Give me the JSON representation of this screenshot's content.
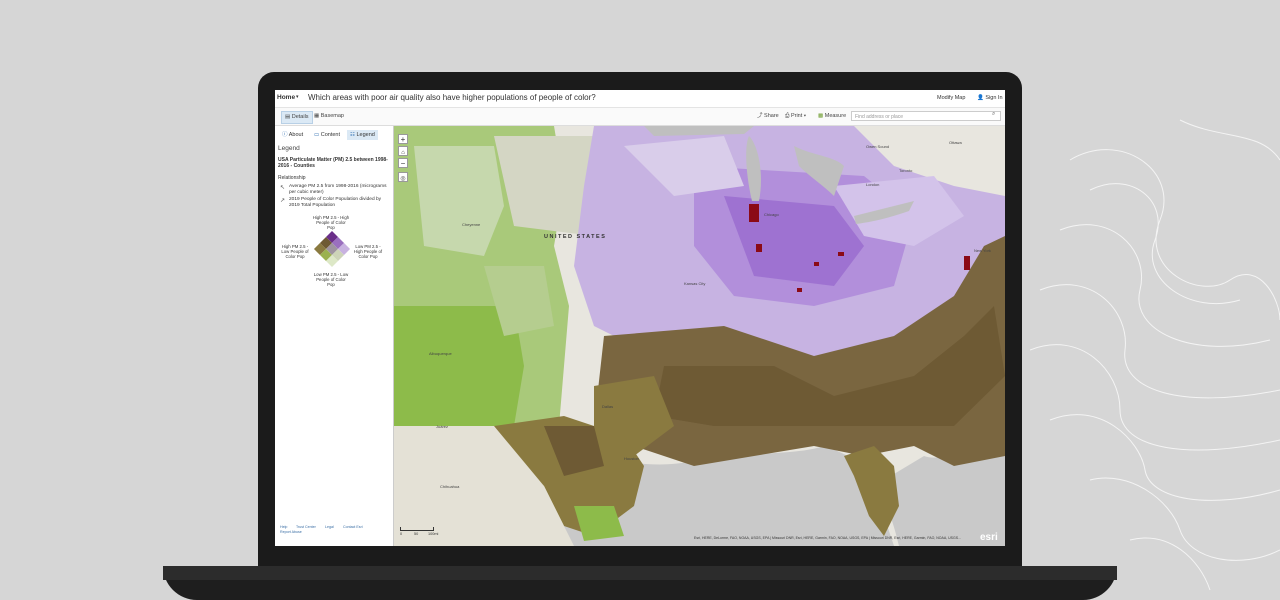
{
  "colors": {
    "background": "#d6d6d6",
    "laptop": "#1b1b1b",
    "accent": "#dbe9f5",
    "map_purple": "#b28fdb",
    "map_green": "#8dbb4a",
    "map_brown": "#6e5a34",
    "map_red": "#8b0a16"
  },
  "topbar": {
    "home": "Home",
    "title": "Which areas with poor air quality also have higher populations of people of color?",
    "modify_map": "Modify Map",
    "sign_in": "Sign In"
  },
  "toolbar": {
    "details": "Details",
    "basemap": "Basemap",
    "share": "Share",
    "print": "Print",
    "measure": "Measure",
    "search_placeholder": "Find address or place"
  },
  "sidebar": {
    "tabs": {
      "about": "About",
      "content": "Content",
      "legend": "Legend"
    },
    "legend_heading": "Legend",
    "layer_title": "USA Particulate Matter (PM) 2.5 between 1998-2016 - Counties",
    "relationship": "Relationship",
    "rel_items": [
      "Average PM 2.5 from 1998-2016 (micrograms per cubic meter)",
      "2019 People of Color Population divided by 2019 Total Population"
    ],
    "diamond": {
      "top": "High PM 2.5 - High People of Color Pop",
      "left": "High PM 2.5 - Low People of Color Pop",
      "right": "Low PM 2.5 - High People of Color Pop",
      "bottom": "Low PM 2.5 - Low People of Color Pop"
    },
    "footer": {
      "help": "Help",
      "trust": "Trust Center",
      "legal": "Legal",
      "contact": "Contact Esri",
      "report": "Report Abuse"
    }
  },
  "map": {
    "country_label": "UNITED STATES",
    "places": [
      "Toronto",
      "Ottawa",
      "Owen Sound",
      "London",
      "Cheyenne",
      "Chicago",
      "Kansas City",
      "Albuquerque",
      "Dallas",
      "Houston",
      "Juárez",
      "Chihuahua",
      "New York"
    ],
    "scale": [
      "0",
      "50",
      "100mi"
    ],
    "attribution": "Esri, HERE, DeLorme, FAO, NOAA, USGS, EPA | Missouri DNR, Esri, HERE, Garmin, FAO, NOAA, USGS, EPA | Missouri DNR, Esri, HERE, Garmin, FAO, NOAA, USGS...",
    "esri_logo": "esri"
  }
}
